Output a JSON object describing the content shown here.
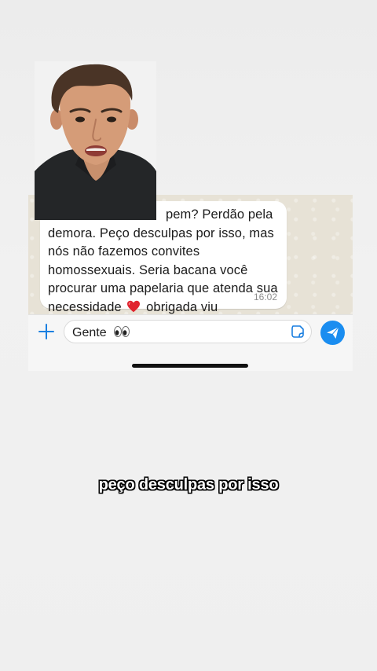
{
  "chat": {
    "message_line1": "pem? Perdão pela",
    "message_line2": "demora. Peço desculpas por isso, mas",
    "message_line3": "nós não fazemos convites",
    "message_line4": "homossexuais. Seria bacana você",
    "message_line5": "procurar uma papelaria que atenda sua",
    "message_line6a": "necessidade",
    "message_line6b": "obrigada viu",
    "time": "16:02"
  },
  "input": {
    "value": "Gente"
  },
  "icons": {
    "plus": "plus-icon",
    "sticker": "sticker-icon",
    "send": "send-icon",
    "heart": "red-heart-emoji",
    "eyes": "eyes-emoji"
  },
  "caption": "peço desculpas por isso",
  "colors": {
    "send_button": "#1a8df0",
    "bubble": "#ffffff",
    "wallpaper": "#e7e2d6",
    "heart": "#e0242f"
  }
}
